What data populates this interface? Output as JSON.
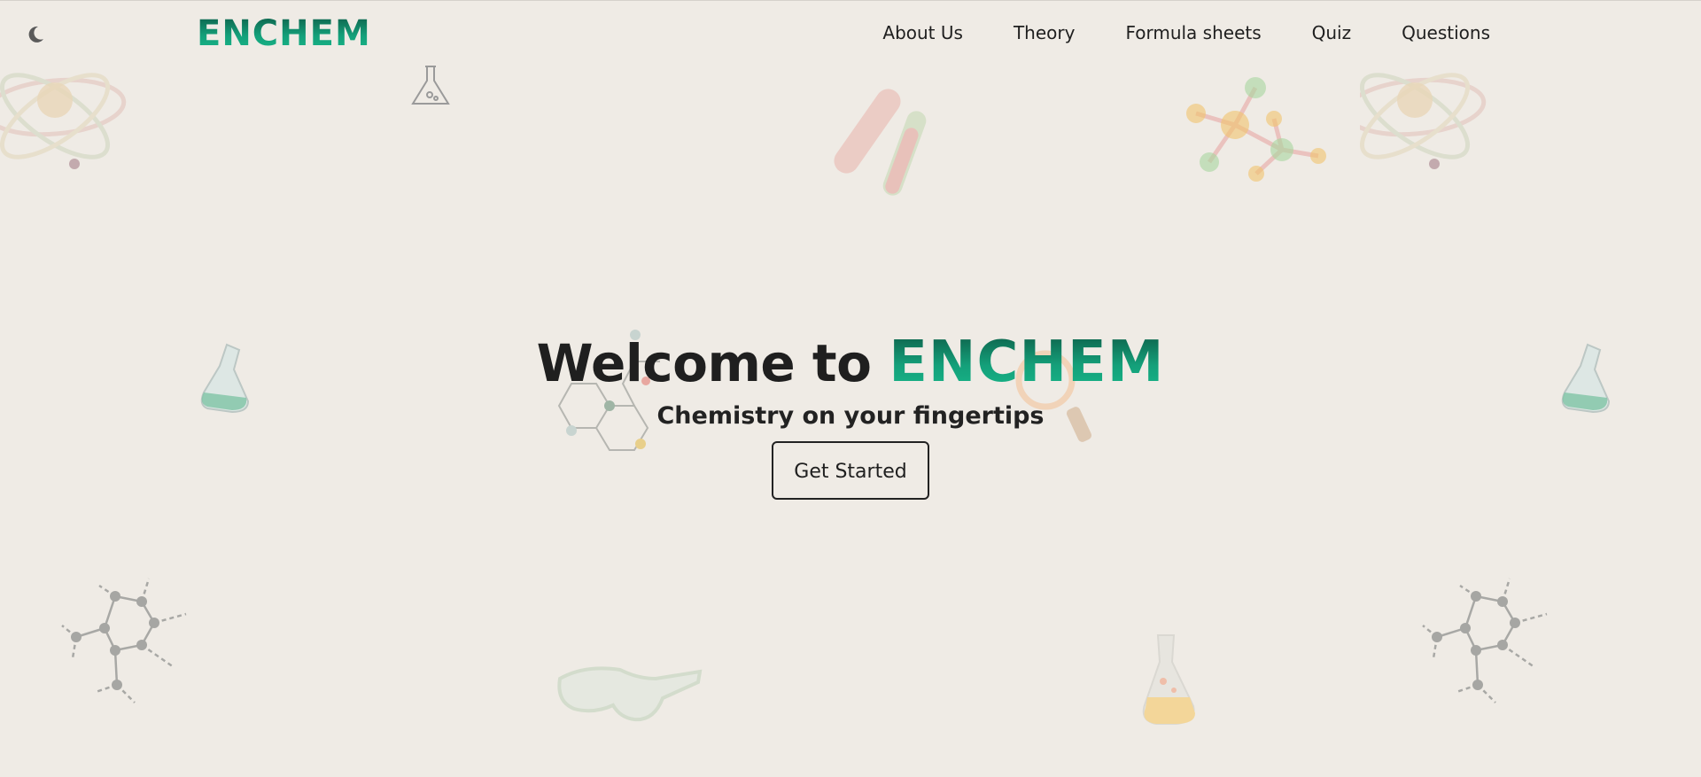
{
  "header": {
    "theme_toggle_icon": "moon-icon",
    "logo": "ENCHEM",
    "nav": [
      {
        "label": "About Us"
      },
      {
        "label": "Theory"
      },
      {
        "label": "Formula sheets"
      },
      {
        "label": "Quiz"
      },
      {
        "label": "Questions"
      }
    ]
  },
  "hero": {
    "title_prefix": "Welcome to",
    "title_brand": "ENCHEM",
    "subtitle": "Chemistry on your fingertips",
    "cta_label": "Get Started"
  },
  "decorations": [
    "atom-icon",
    "flask-outline-icon",
    "test-tubes-icon",
    "molecule-icon",
    "atom-icon",
    "flask-icon",
    "hexagon-molecule-icon",
    "magnifier-icon",
    "flask-icon",
    "molecule-structure-icon",
    "goggles-icon",
    "flask-icon",
    "molecule-structure-icon"
  ],
  "colors": {
    "background": "#efebe5",
    "brand_dark": "#0d5a45",
    "brand_light": "#18b88a",
    "text": "#1f1f1f"
  }
}
